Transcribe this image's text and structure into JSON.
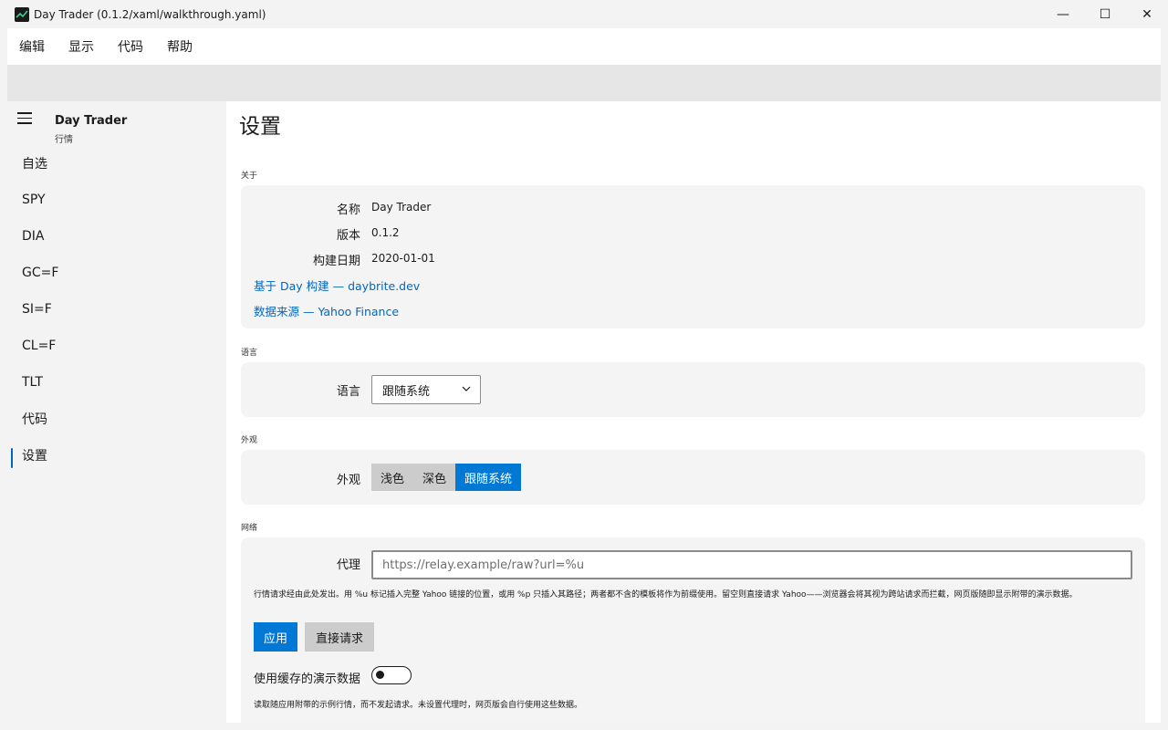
{
  "window": {
    "title": "Day Trader (0.1.2/xaml/walkthrough.yaml)",
    "minimize": "—",
    "maximize": "☐",
    "close": "✕"
  },
  "menu": [
    "编辑",
    "显示",
    "代码",
    "帮助"
  ],
  "sidebar": {
    "title": "Day Trader",
    "subtitle": "行情",
    "items": [
      "自选",
      "SPY",
      "DIA",
      "GC=F",
      "SI=F",
      "CL=F",
      "TLT",
      "代码",
      "设置"
    ],
    "active_index": 8
  },
  "page": {
    "title": "设置",
    "about": {
      "section": "关于",
      "name_label": "名称",
      "name_value": "Day Trader",
      "version_label": "版本",
      "version_value": "0.1.2",
      "build_label": "构建日期",
      "build_value": "2020-01-01",
      "link_day": "基于 Day 构建 — daybrite.dev",
      "link_data": "数据来源 — Yahoo Finance"
    },
    "language": {
      "section": "语言",
      "label": "语言",
      "selected": "跟随系统"
    },
    "appearance": {
      "section": "外观",
      "label": "外观",
      "options": [
        "浅色",
        "深色",
        "跟随系统"
      ],
      "selected_index": 2
    },
    "network": {
      "section": "网络",
      "proxy_label": "代理",
      "proxy_placeholder": "https://relay.example/raw?url=%u",
      "help": "行情请求经由此处发出。用 %u 标记插入完整 Yahoo 链接的位置，或用 %p 只插入其路径；两者都不含的模板将作为前缀使用。留空则直接请求 Yahoo——浏览器会将其视为跨站请求而拦截，网页版随即显示附带的演示数据。",
      "apply": "应用",
      "direct": "直接请求",
      "toggle_label": "使用缓存的演示数据",
      "toggle_on": false,
      "toggle_help": "读取随应用附带的示例行情，而不发起请求。未设置代理时，网页版会自行使用这些数据。"
    }
  },
  "colors": {
    "accent": "#0078d4",
    "link": "#0067c0"
  }
}
